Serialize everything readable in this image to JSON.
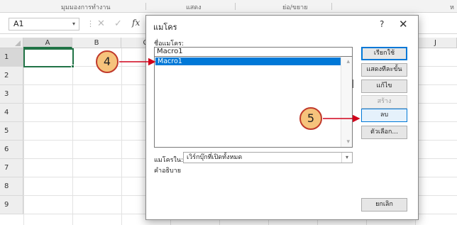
{
  "ribbon": {
    "groups": [
      "มุมมองการทำงาน",
      "แสดง",
      "ย่อ/ขยาย",
      "ห"
    ]
  },
  "formula_bar": {
    "name_box": "A1",
    "name_box_caret": "▾",
    "dots": "⋮",
    "cancel_symbol": "✕",
    "enter_symbol": "✓",
    "fx_label": "fx"
  },
  "sheet": {
    "columns": [
      "A",
      "B",
      "C",
      "J"
    ],
    "rows": [
      "1",
      "2",
      "3",
      "4",
      "5",
      "6",
      "7",
      "8",
      "9"
    ],
    "active_cell": "A1"
  },
  "dialog": {
    "title": "แมโคร",
    "help": "?",
    "close": "✕",
    "macro_name_label": "ชื่อแมโคร:",
    "macro_name_value": "Macro1",
    "upload_symbol": "⭱",
    "macro_list": [
      "Macro1"
    ],
    "selected_macro": "Macro1",
    "scroll_up": "▴",
    "scroll_down": "▾",
    "macros_in_label": "แมโครใน:",
    "macros_in_value": "เวิร์กบุ๊กที่เปิดทั้งหมด",
    "macros_in_caret": "▾",
    "description_label": "คำอธิบาย",
    "buttons": {
      "run": "เรียกใช้",
      "step_into": "แสดงทีละขั้น",
      "edit": "แก้ไข",
      "create": "สร้าง",
      "delete": "ลบ",
      "options": "ตัวเลือก...",
      "cancel": "ยกเลิก"
    }
  },
  "callouts": {
    "step_4": "4",
    "step_5": "5"
  },
  "colors": {
    "selection": "#0078d7",
    "callout_fill": "#f6c37c",
    "callout_border": "#c0392b",
    "excel_green": "#217346"
  }
}
